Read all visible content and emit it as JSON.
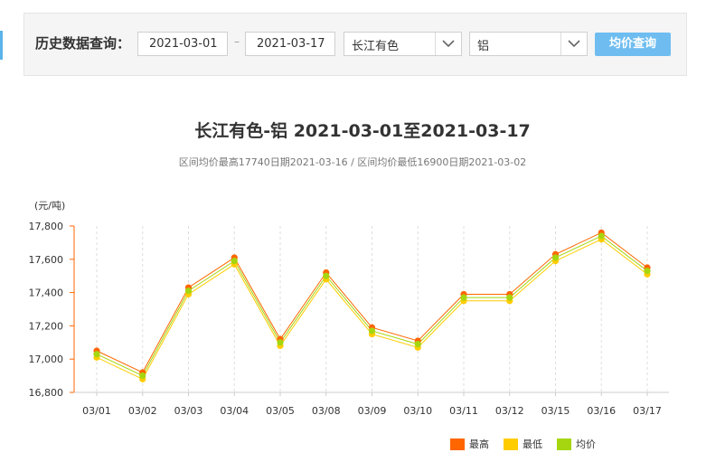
{
  "query": {
    "label": "历史数据查询：",
    "start_date": "2021-03-01",
    "range_separator": "–",
    "end_date": "2021-03-17",
    "market_select": "长江有色",
    "metal_select": "铝",
    "submit_label": "均价查询"
  },
  "colors": {
    "high": "#ff6600",
    "low": "#ffcc00",
    "avg": "#a5d610",
    "button": "#6fbdf0",
    "axis": "#ff6600"
  },
  "chart_data": {
    "type": "line",
    "title": "长江有色-铝 2021-03-01至2021-03-17",
    "subtitle": "区间均价最高17740日期2021-03-16 / 区间均价最低16900日期2021-03-02",
    "ylabel": "(元/吨)",
    "ylim": [
      16800,
      17800
    ],
    "yticks": [
      16800,
      17000,
      17200,
      17400,
      17600,
      17800
    ],
    "ytick_labels": [
      "16,800",
      "17,000",
      "17,200",
      "17,400",
      "17,600",
      "17,800"
    ],
    "categories": [
      "03/01",
      "03/02",
      "03/03",
      "03/04",
      "03/05",
      "03/08",
      "03/09",
      "03/10",
      "03/11",
      "03/12",
      "03/15",
      "03/16",
      "03/17"
    ],
    "grid": "vertical dashed",
    "legend_position": "bottom-right",
    "series": [
      {
        "name": "最高",
        "color_key": "high",
        "values": [
          17050,
          16920,
          17430,
          17610,
          17120,
          17520,
          17190,
          17110,
          17390,
          17390,
          17630,
          17760,
          17550
        ]
      },
      {
        "name": "最低",
        "color_key": "low",
        "values": [
          17010,
          16880,
          17390,
          17570,
          17080,
          17480,
          17150,
          17070,
          17350,
          17350,
          17590,
          17720,
          17510
        ]
      },
      {
        "name": "均价",
        "color_key": "avg",
        "values": [
          17030,
          16900,
          17410,
          17590,
          17100,
          17500,
          17170,
          17090,
          17370,
          17370,
          17610,
          17740,
          17530
        ]
      }
    ]
  }
}
